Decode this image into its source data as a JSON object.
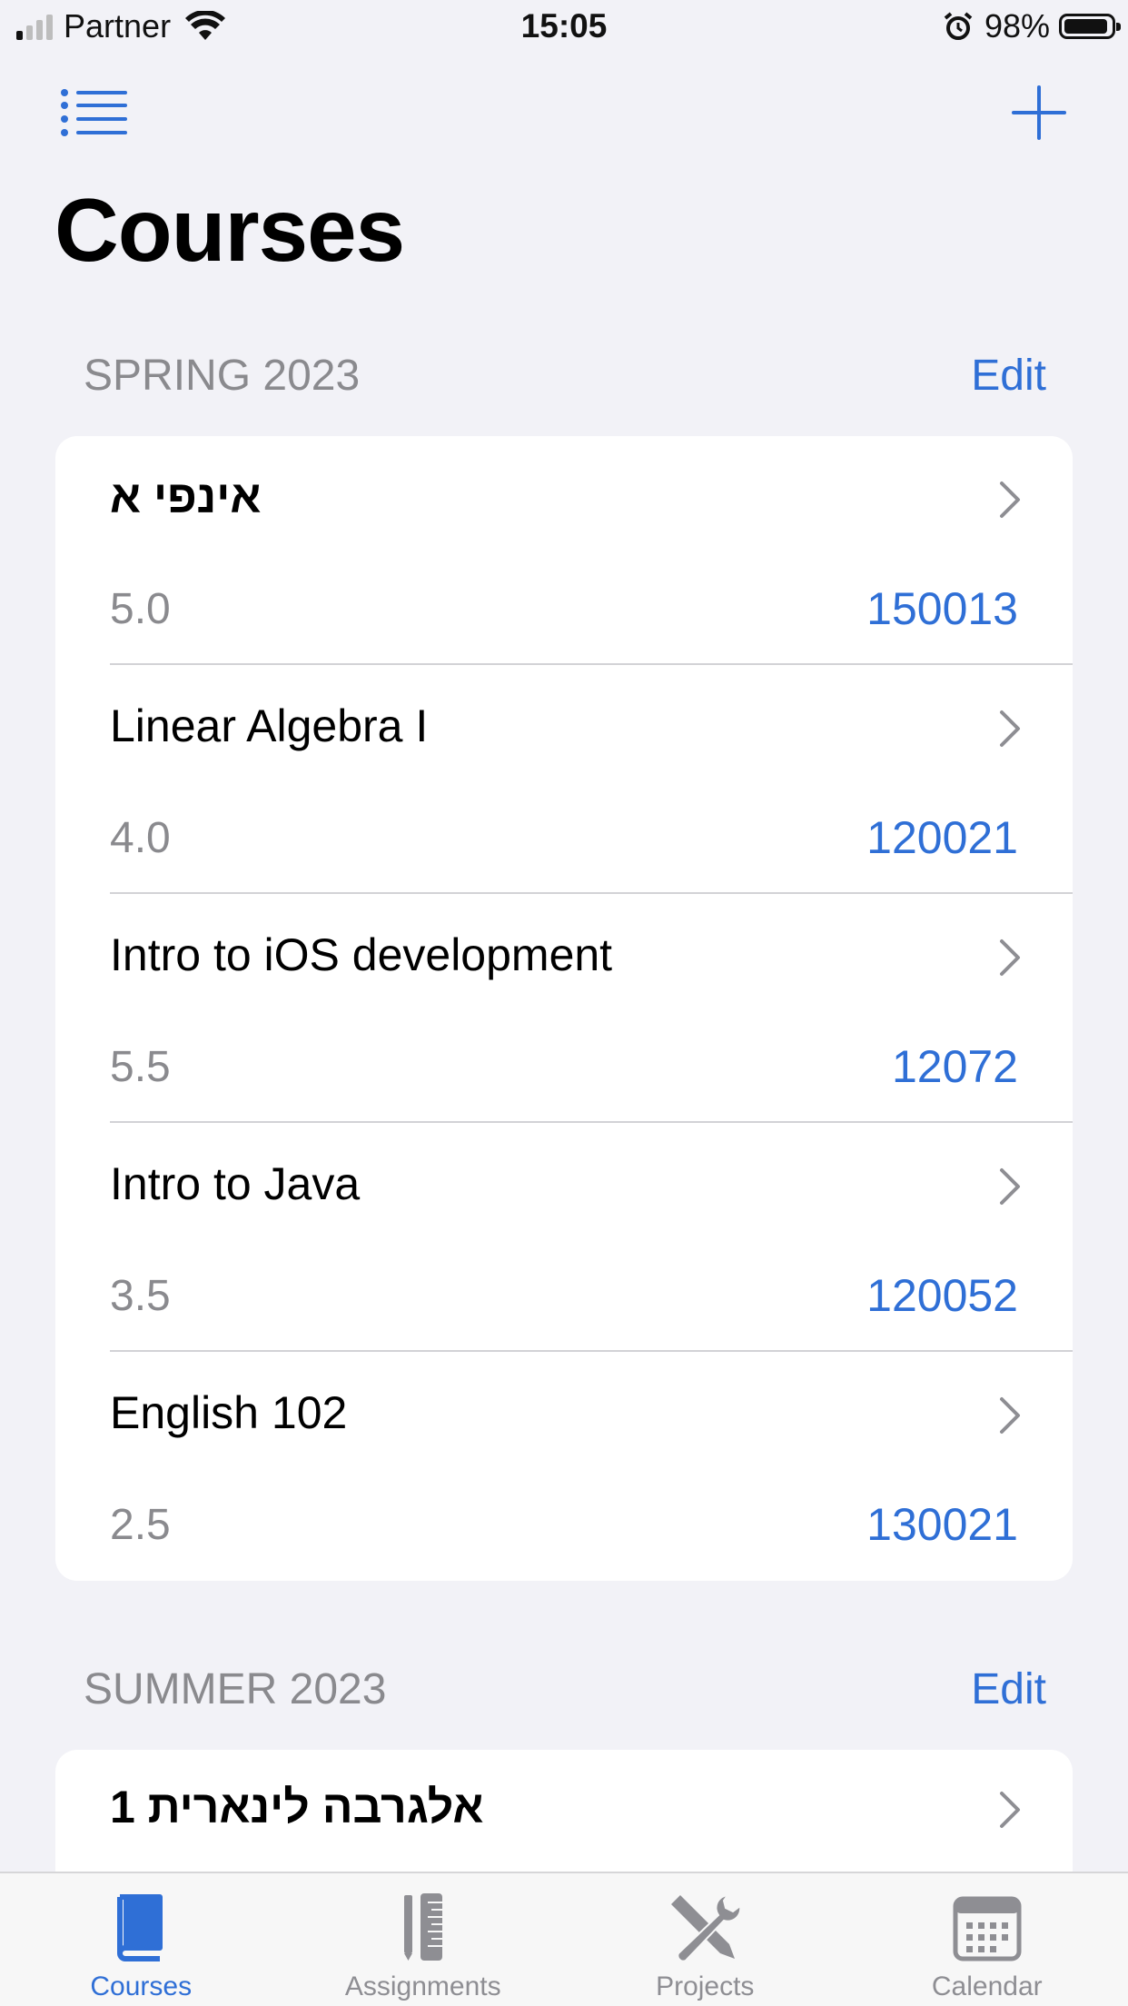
{
  "status_bar": {
    "carrier": "Partner",
    "time": "15:05",
    "battery": "98%",
    "battery_level": 0.98
  },
  "nav": {
    "title": "Courses"
  },
  "sections": [
    {
      "title": "SPRING 2023",
      "edit_label": "Edit",
      "courses": [
        {
          "name": "אינפי א",
          "credits": "5.0",
          "id": "150013"
        },
        {
          "name": "Linear Algebra I",
          "credits": "4.0",
          "id": "120021"
        },
        {
          "name": "Intro to iOS development",
          "credits": "5.5",
          "id": "12072"
        },
        {
          "name": "Intro to Java",
          "credits": "3.5",
          "id": "120052"
        },
        {
          "name": "English 102",
          "credits": "2.5",
          "id": "130021"
        }
      ]
    },
    {
      "title": "SUMMER 2023",
      "edit_label": "Edit",
      "courses": [
        {
          "name": "אלגרבה לינארית 1"
        }
      ]
    }
  ],
  "tab_bar": {
    "tabs": [
      {
        "label": "Courses",
        "icon": "book-icon",
        "active": true
      },
      {
        "label": "Assignments",
        "icon": "pencil-ruler-icon",
        "active": false
      },
      {
        "label": "Projects",
        "icon": "wrench-screwdriver-icon",
        "active": false
      },
      {
        "label": "Calendar",
        "icon": "calendar-icon",
        "active": false
      }
    ]
  },
  "colors": {
    "accent": "#2f6fd6",
    "background": "#f2f2f7",
    "secondary_text": "#8a8a8e"
  }
}
